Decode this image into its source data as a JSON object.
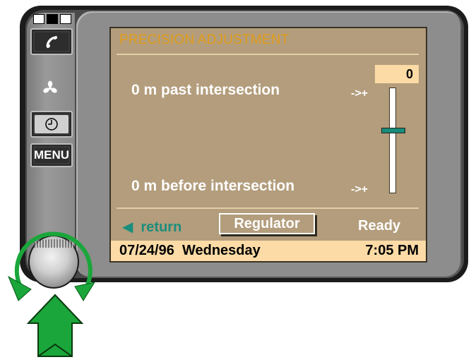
{
  "screen": {
    "title": "PRECISION ADJUSTMENT",
    "top_label": "0 m past intersection",
    "bottom_label": "0 m before intersection",
    "top_arrow": "->+",
    "bottom_arrow": "->+",
    "value": "0",
    "slider_value": 0,
    "return_label": "return",
    "return_icon": "left-triangle-icon",
    "regulator_label": "Regulator",
    "status_label": "Ready",
    "date": "07/24/96",
    "weekday": "Wednesday",
    "time": "7:05 PM"
  },
  "side_panel": {
    "menu_label": "MENU",
    "buttons": [
      "phone-icon",
      "fan-icon",
      "clock-icon"
    ]
  },
  "colors": {
    "screen_bg": "#b39d7c",
    "title": "#e39d1a",
    "accent": "#1b8e7d",
    "status_bar": "#fcdba6",
    "arrow_green": "#1aa63a"
  }
}
